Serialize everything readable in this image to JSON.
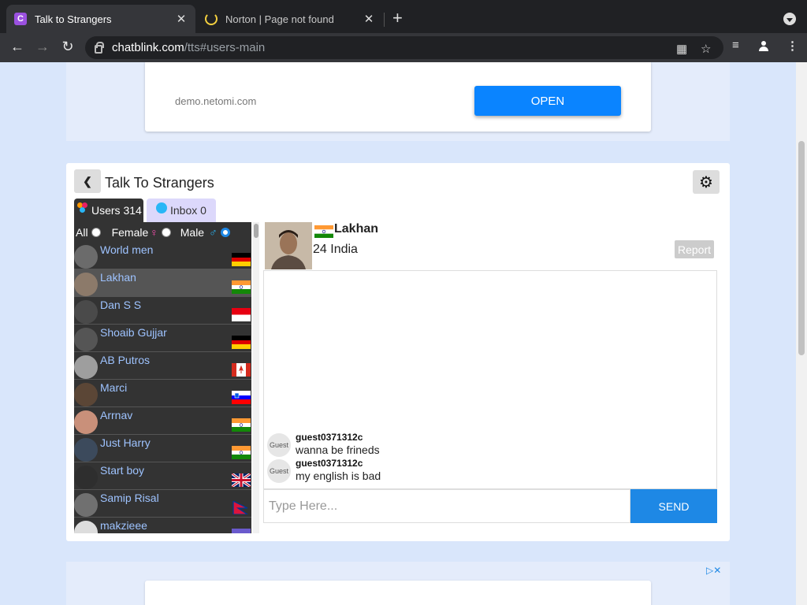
{
  "browser": {
    "tabs": [
      {
        "title": "Talk to Strangers",
        "favicon": "C"
      },
      {
        "title": "Norton | Page not found"
      }
    ],
    "url_host": "chatblink.com",
    "url_path": "/tts#users-main"
  },
  "ad_top": {
    "domain": "demo.netomi.com",
    "button": "OPEN"
  },
  "app": {
    "title": "Talk To Strangers",
    "tabs": {
      "users": "Users 314",
      "inbox": "Inbox 0"
    },
    "filters": {
      "all": "All",
      "female": "Female",
      "male": "Male",
      "selected": "male"
    },
    "users": [
      {
        "name": "World men",
        "flag": "germany"
      },
      {
        "name": "Lakhan",
        "flag": "india",
        "selected": true
      },
      {
        "name": "Dan S S",
        "flag": "indonesia"
      },
      {
        "name": "Shoaib Gujjar",
        "flag": "germany"
      },
      {
        "name": "AB Putros",
        "flag": "canada"
      },
      {
        "name": "Marci",
        "flag": "slovenia"
      },
      {
        "name": "Arrnav",
        "flag": "india"
      },
      {
        "name": "Just Harry",
        "flag": "india"
      },
      {
        "name": "Start boy",
        "flag": "uk"
      },
      {
        "name": "Samip Risal",
        "flag": "nepal"
      },
      {
        "name": "makzieee",
        "flag": "other"
      }
    ],
    "profile": {
      "name": "Lakhan",
      "meta": "24 India",
      "report": "Report"
    },
    "messages": [
      {
        "avatar": "Guest",
        "user": "guest0371312c",
        "text": "wanna be frineds"
      },
      {
        "avatar": "Guest",
        "user": "guest0371312c",
        "text": "my english is bad"
      }
    ],
    "input_placeholder": "Type Here...",
    "send": "SEND"
  },
  "colors": {
    "accent": "#1e88e5",
    "ad_button": "#0a84ff",
    "list_bg": "#333333",
    "username": "#9ec3ff"
  }
}
